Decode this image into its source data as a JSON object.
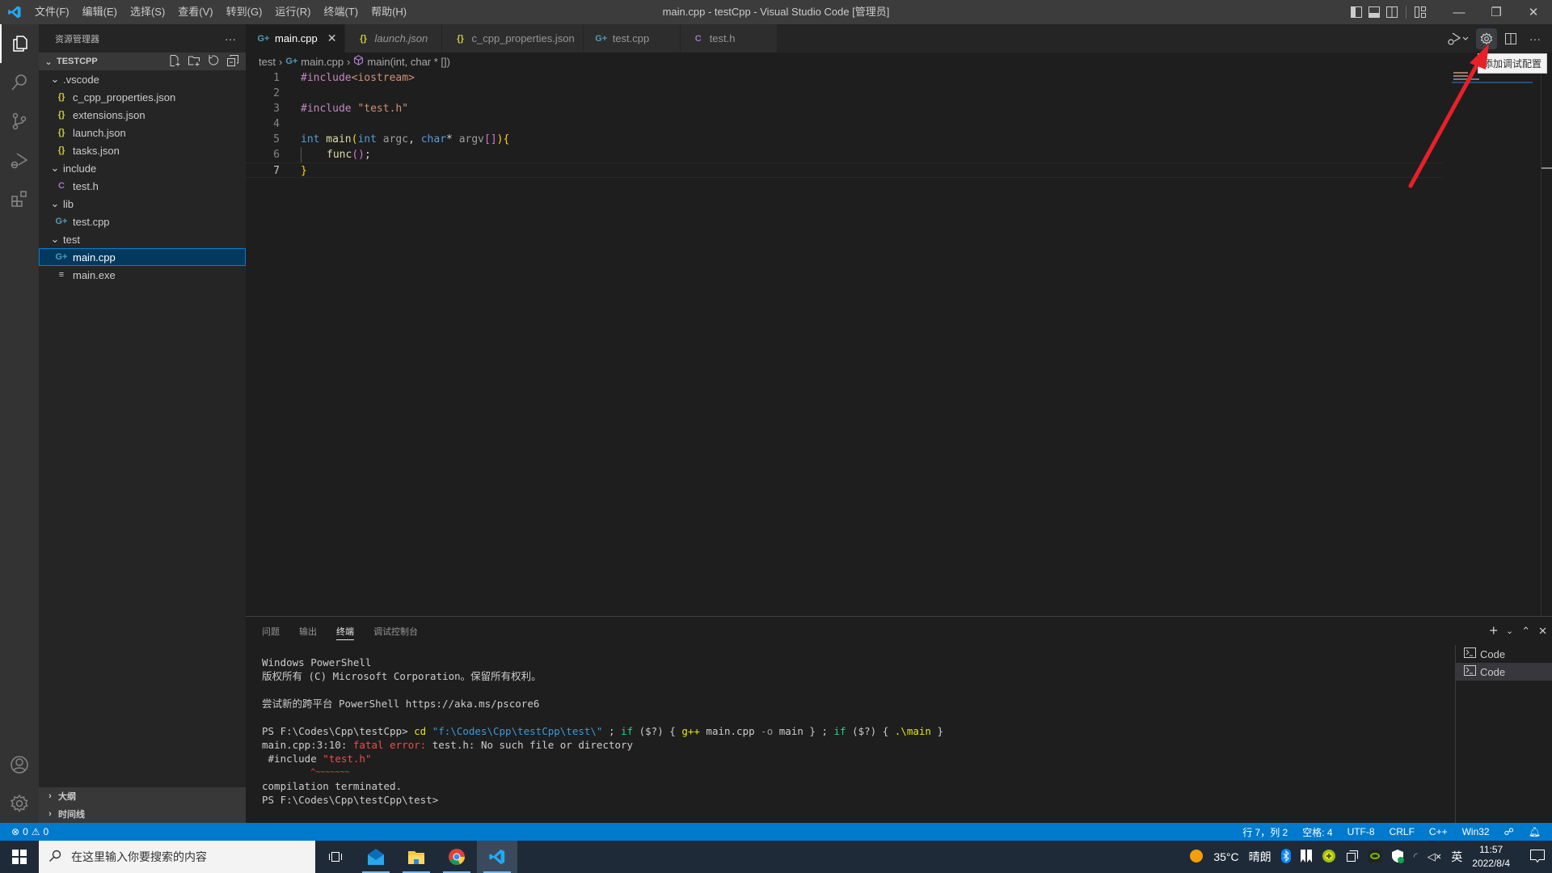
{
  "titlebar": {
    "window_title": "main.cpp - testCpp - Visual Studio Code [管理员]",
    "menu": [
      "文件(F)",
      "编辑(E)",
      "选择(S)",
      "查看(V)",
      "转到(G)",
      "运行(R)",
      "终端(T)",
      "帮助(H)"
    ],
    "controls": {
      "minimize": "—",
      "restore": "❐",
      "close": "✕"
    }
  },
  "activity_bar": {
    "items": [
      "explorer",
      "search",
      "source-control",
      "run-and-debug",
      "extensions"
    ],
    "bottom": [
      "accounts",
      "manage"
    ]
  },
  "sidebar": {
    "title": "资源管理器",
    "more": "···",
    "root": "TESTCPP",
    "tree": [
      {
        "label": ".vscode",
        "type": "folder",
        "depth": 1
      },
      {
        "label": "c_cpp_properties.json",
        "type": "json",
        "depth": 2
      },
      {
        "label": "extensions.json",
        "type": "json",
        "depth": 2
      },
      {
        "label": "launch.json",
        "type": "json",
        "depth": 2
      },
      {
        "label": "tasks.json",
        "type": "json",
        "depth": 2
      },
      {
        "label": "include",
        "type": "folder",
        "depth": 1
      },
      {
        "label": "test.h",
        "type": "c",
        "depth": 2
      },
      {
        "label": "lib",
        "type": "folder",
        "depth": 1
      },
      {
        "label": "test.cpp",
        "type": "cpp",
        "depth": 2
      },
      {
        "label": "test",
        "type": "folder",
        "depth": 1
      },
      {
        "label": "main.cpp",
        "type": "cpp",
        "depth": 2,
        "selected": true
      },
      {
        "label": "main.exe",
        "type": "exe",
        "depth": 2
      }
    ],
    "sections": [
      "大纲",
      "时间线"
    ]
  },
  "editor": {
    "tabs": [
      {
        "label": "main.cpp",
        "icon": "cpp",
        "active": true,
        "italic": false
      },
      {
        "label": "launch.json",
        "icon": "json",
        "active": false,
        "italic": true
      },
      {
        "label": "c_cpp_properties.json",
        "icon": "json",
        "active": false,
        "italic": false
      },
      {
        "label": "test.cpp",
        "icon": "cpp",
        "active": false,
        "italic": false
      },
      {
        "label": "test.h",
        "icon": "c",
        "active": false,
        "italic": false
      }
    ],
    "breadcrumb": [
      "test",
      "main.cpp",
      "main(int, char * [])"
    ],
    "tooltip": "添加调试配置",
    "lines": [
      "1",
      "2",
      "3",
      "4",
      "5",
      "6",
      "7"
    ],
    "code": {
      "l1_a": "#include",
      "l1_b": "<iostream>",
      "l3_a": "#include ",
      "l3_b": "\"test.h\"",
      "l5_int": "int",
      "l5_main": " main",
      "l5_p1": "(",
      "l5_int2": "int",
      "l5_argc": " argc",
      "l5_comma": ", ",
      "l5_char": "char",
      "l5_star": "*",
      "l5_argv": " argv",
      "l5_b1": "[",
      "l5_b2": "]",
      "l5_p2": ")",
      "l5_brace": "{",
      "l6_fn": "func",
      "l6_p": "()",
      "l6_semi": ";",
      "l7": "}"
    }
  },
  "panel": {
    "tabs": [
      "问题",
      "输出",
      "终端",
      "调试控制台"
    ],
    "active_tab": "终端",
    "terminal": {
      "l1": "Windows PowerShell",
      "l2": "版权所有 (C) Microsoft Corporation。保留所有权利。",
      "l4": "尝试新的跨平台 PowerShell https://aka.ms/pscore6",
      "l6_prompt": "PS F:\\Codes\\Cpp\\testCpp> ",
      "l6_cd": "cd",
      "l6_path": " \"f:\\Codes\\Cpp\\testCpp\\test\\\"",
      "l6_semi1": " ; ",
      "l6_if1": "if",
      "l6_c1": " ($?) { ",
      "l6_gpp": "g++",
      "l6_main": " main.cpp ",
      "l6_o": "-o",
      "l6_rest": " main } ; ",
      "l6_if2": "if",
      "l6_c2": " ($?) { ",
      "l6_run": ".\\main",
      "l6_end": " }",
      "l7_loc": "main.cpp:3:10: ",
      "l7_err": "fatal error: ",
      "l7_msg": "test.h: No such file or directory",
      "l8_a": " #include ",
      "l8_b": "\"test.h\"",
      "l9": "          ^~~~~~~~",
      "l10": "compilation terminated.",
      "l11": "PS F:\\Codes\\Cpp\\testCpp\\test>"
    },
    "terminal_instances": [
      "Code",
      "Code"
    ]
  },
  "statusbar": {
    "errors": "0",
    "warnings": "0",
    "position": "行 7，列 2",
    "spaces": "空格: 4",
    "encoding": "UTF-8",
    "eol": "CRLF",
    "language": "C++",
    "platform": "Win32"
  },
  "taskbar": {
    "search_placeholder": "在这里输入你要搜索的内容",
    "weather_temp": "35°C",
    "weather_desc": "晴朗",
    "ime": "英",
    "time": "11:57",
    "date": "2022/8/4"
  },
  "colors": {
    "accent": "#007acc",
    "annotation_arrow": "#e8202a"
  }
}
